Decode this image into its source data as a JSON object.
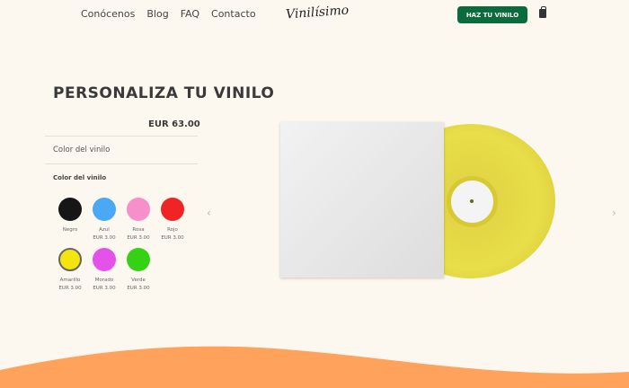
{
  "nav": {
    "items": [
      "Conócenos",
      "Blog",
      "FAQ",
      "Contacto"
    ],
    "logo": "Vinilísimo",
    "cta": "HAZ TU VINILO",
    "cart_icon": "shopping-bag-icon"
  },
  "product": {
    "title": "PERSONALIZA TU VINILO",
    "price": "EUR 63.00",
    "option_section": "Color del vinilo",
    "option_label": "Color del vinilo",
    "colors": [
      {
        "name": "Negro",
        "price": "",
        "hex": "#161616"
      },
      {
        "name": "Azul",
        "price": "EUR 3.00",
        "hex": "#4aa8f5"
      },
      {
        "name": "Rosa",
        "price": "EUR 3.00",
        "hex": "#f78fca"
      },
      {
        "name": "Rojo",
        "price": "EUR 3.00",
        "hex": "#f02424"
      },
      {
        "name": "Amarillo",
        "price": "EUR 3.00",
        "hex": "#f5e50e",
        "selected": true
      },
      {
        "name": "Morado",
        "price": "EUR 3.00",
        "hex": "#e552ea"
      },
      {
        "name": "Verde",
        "price": "EUR 3.00",
        "hex": "#34d114"
      }
    ]
  },
  "colors": {
    "accent": "#0a6b3d",
    "background": "#fdf8ef",
    "wave": "#ffa35c"
  }
}
